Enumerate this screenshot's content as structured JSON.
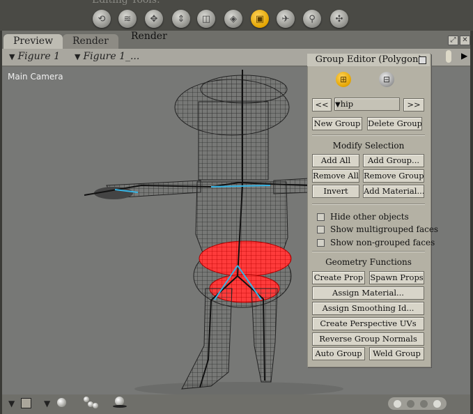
{
  "toolbar": {
    "label": "Editing Tools:",
    "tools": [
      {
        "name": "rotate-tool-icon",
        "glyph": "⟲"
      },
      {
        "name": "twist-tool-icon",
        "glyph": "≋"
      },
      {
        "name": "translate-tool-icon",
        "glyph": "✥"
      },
      {
        "name": "scale-tool-icon",
        "glyph": "⇕"
      },
      {
        "name": "taper-tool-icon",
        "glyph": "◫"
      },
      {
        "name": "color-tool-icon",
        "glyph": "◈"
      },
      {
        "name": "grouping-tool-icon",
        "glyph": "▣"
      },
      {
        "name": "view-magnifier-icon",
        "glyph": "✈"
      },
      {
        "name": "zoom-tool-icon",
        "glyph": "⚲"
      },
      {
        "name": "direct-manipulation-icon",
        "glyph": "✣"
      }
    ]
  },
  "tabs": {
    "preview": "Preview",
    "render": "Render"
  },
  "window": {
    "title": "Render"
  },
  "figure_selectors": {
    "figure": "Figure 1",
    "part": "Figure 1_..."
  },
  "viewport": {
    "camera_label": "Main Camera"
  },
  "group_editor": {
    "title": "Group Editor  (Polygon)",
    "group_nav": {
      "prev": "<<",
      "current": "hip",
      "next": ">>"
    },
    "new_group": "New Group",
    "delete_group": "Delete Group",
    "modify_selection_label": "Modify Selection",
    "add_all": "Add All",
    "add_group": "Add Group...",
    "remove_all": "Remove All",
    "remove_group": "Remove Group...",
    "invert": "Invert",
    "add_material": "Add Material...",
    "options": [
      {
        "label": "Hide other objects",
        "checked": false
      },
      {
        "label": "Show multigrouped faces",
        "checked": false
      },
      {
        "label": "Show non-grouped faces",
        "checked": false
      }
    ],
    "geometry_label": "Geometry Functions",
    "create_prop": "Create Prop",
    "spawn_props": "Spawn Props",
    "assign_material": "Assign Material...",
    "assign_smoothing": "Assign Smoothing Id...",
    "create_uvs": "Create Perspective UVs",
    "reverse_normals": "Reverse Group Normals",
    "auto_group": "Auto Group",
    "weld_group": "Weld Group"
  },
  "colors": {
    "accent": "#e3a400",
    "selection": "#ff2a2a",
    "bone": "#35b5e6"
  }
}
